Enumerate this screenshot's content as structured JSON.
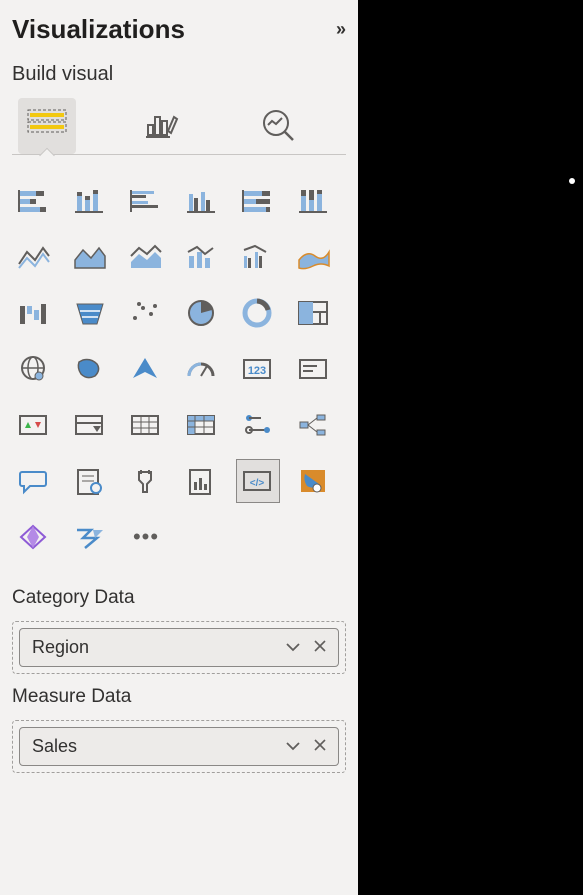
{
  "panel": {
    "title": "Visualizations",
    "subtitle": "Build visual"
  },
  "fields": {
    "category": {
      "label": "Category Data",
      "value": "Region"
    },
    "measure": {
      "label": "Measure Data",
      "value": "Sales"
    }
  }
}
